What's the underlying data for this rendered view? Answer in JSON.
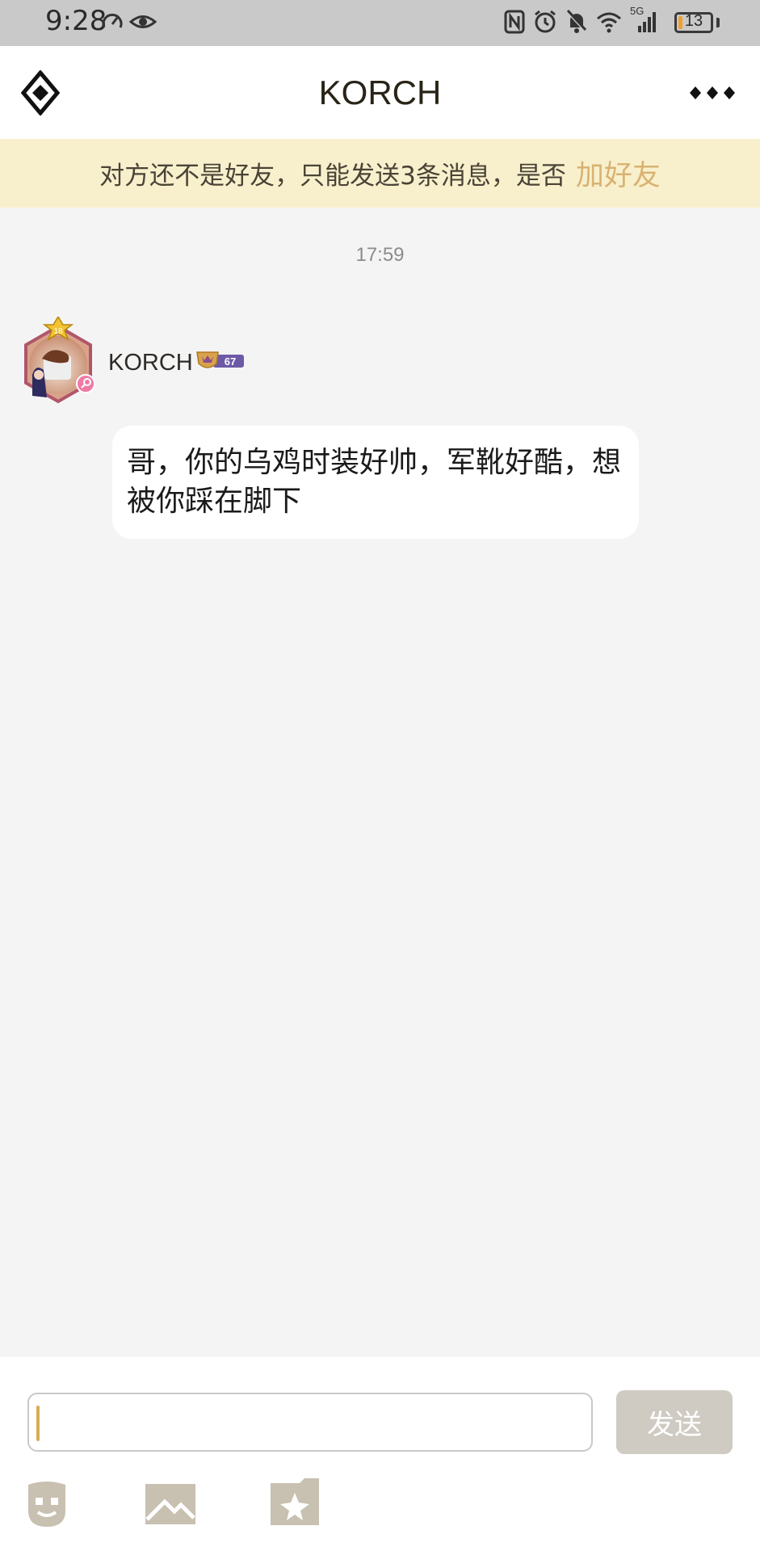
{
  "status_bar": {
    "time": "9:28",
    "battery": "13",
    "network": "5G",
    "icons": [
      "speedometer-icon",
      "eye-icon",
      "nfc-icon",
      "alarm-icon",
      "bell-off-icon",
      "wifi-icon",
      "signal-icon",
      "battery-icon"
    ],
    "battery_fill_fraction": 0.13
  },
  "header": {
    "title": "KORCH",
    "back_icon": "back-icon",
    "more_icon": "more-icon"
  },
  "friend_banner": {
    "text": "对方还不是好友，只能发送3条消息，是否",
    "link": "加好友"
  },
  "chat": {
    "timestamp": "17:59",
    "messages": [
      {
        "sender": "KORCH",
        "avatar_level": "18",
        "vip_level": "67",
        "text": "哥，你的乌鸡时装好帅，军靴好酷，想被你踩在脚下"
      }
    ]
  },
  "input_bar": {
    "placeholder": "",
    "send_label": "发送",
    "tools": [
      "emoji-icon",
      "image-icon",
      "sticker-icon"
    ]
  },
  "colors": {
    "banner_bg": "#f8f0cc",
    "accent": "#d9b272",
    "send_disabled": "#cfcbc3",
    "chat_bg": "#f4f4f4",
    "status_bar": "#c9c9c9"
  }
}
